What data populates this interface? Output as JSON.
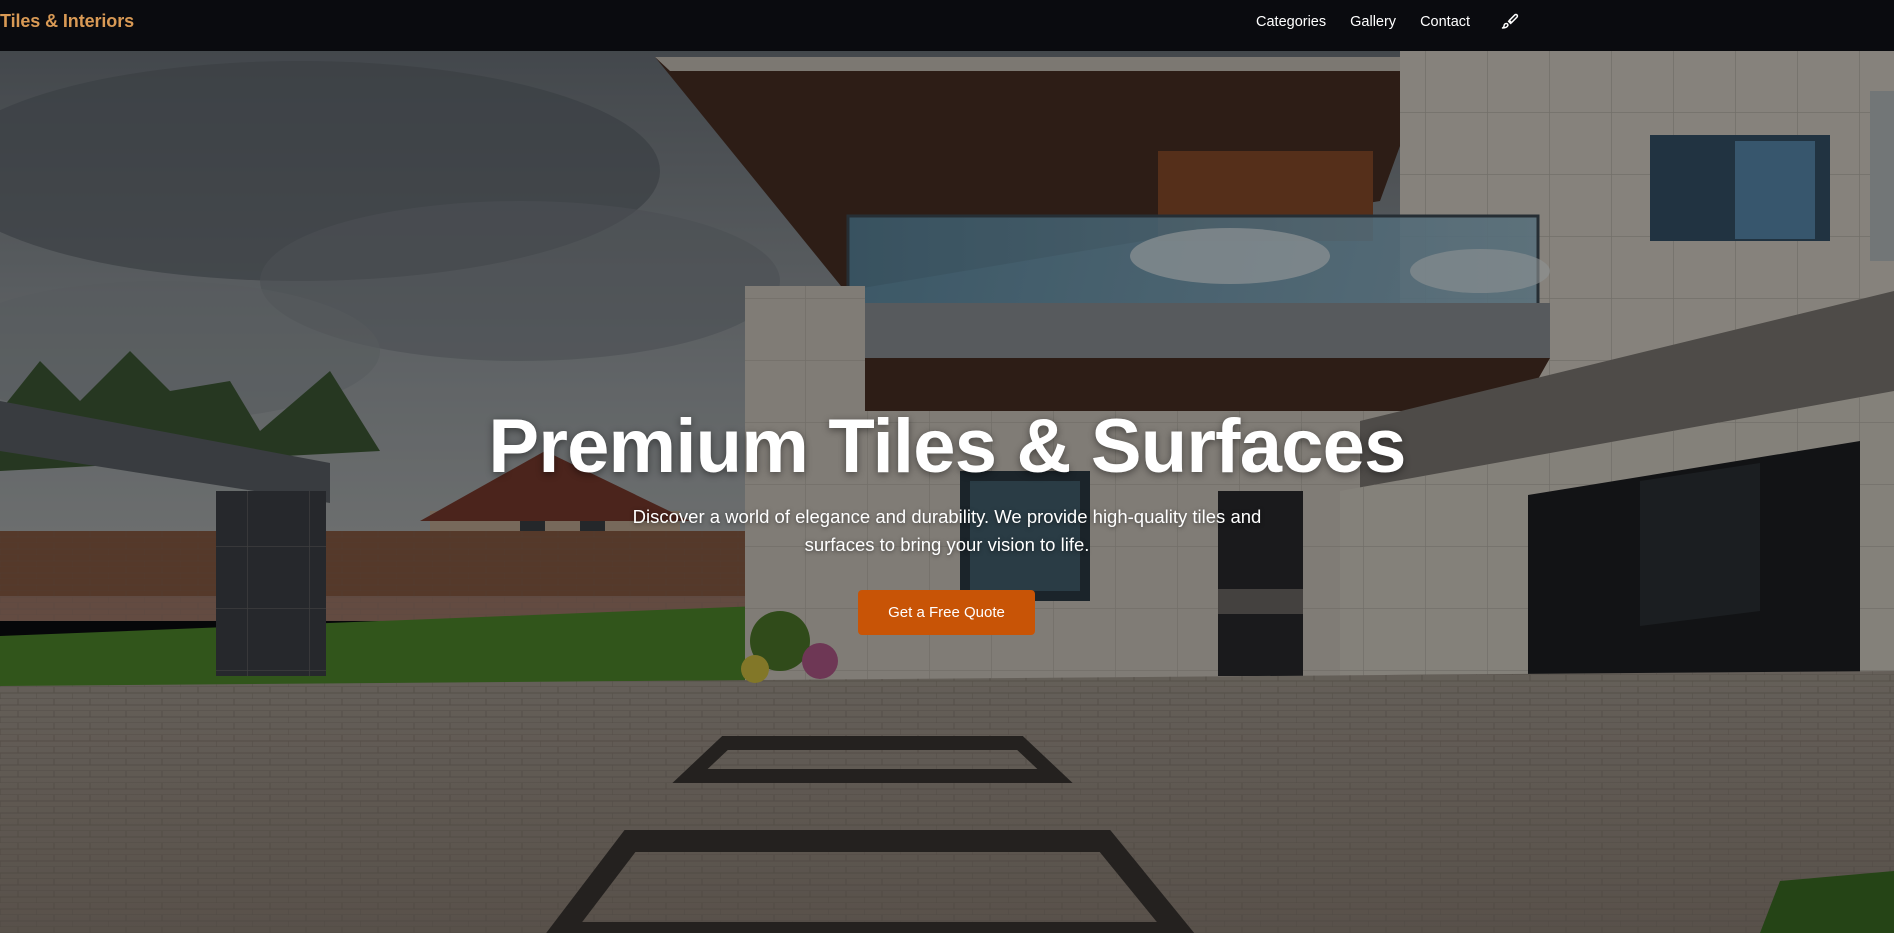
{
  "brand": {
    "name": "Tiles & Interiors",
    "color": "#d99a55"
  },
  "nav": {
    "links": [
      {
        "label": "Categories"
      },
      {
        "label": "Gallery"
      },
      {
        "label": "Contact"
      }
    ],
    "theme_icon": "paintbrush-icon"
  },
  "hero": {
    "title": "Premium Tiles & Surfaces",
    "subtitle": "Discover a world of elegance and durability. We provide high-quality tiles and surfaces to bring your vision to life.",
    "cta_label": "Get a Free Quote",
    "cta_color": "#c85406",
    "background": "modern-house-with-paved-driveway-photo"
  }
}
